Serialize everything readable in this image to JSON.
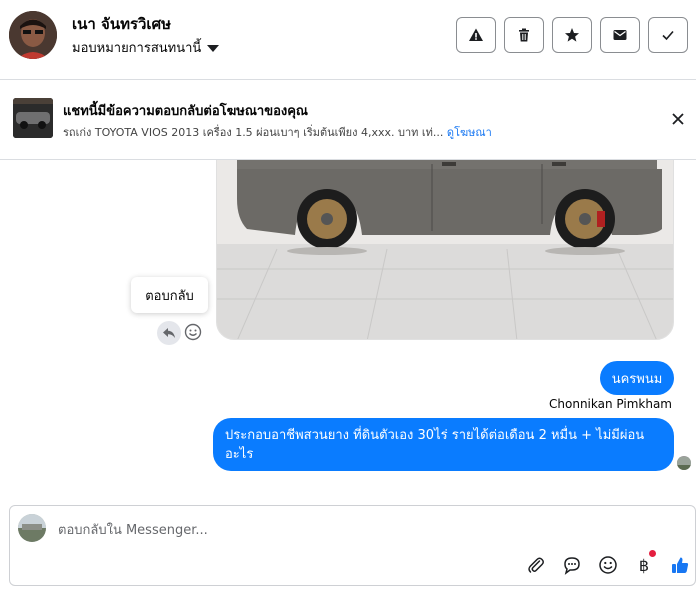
{
  "header": {
    "contact_name": "เนา จันทรวิเศษ",
    "assign_label": "มอบหมายการสนทนานี้",
    "tools": [
      {
        "name": "report-button",
        "icon": "warning-icon"
      },
      {
        "name": "delete-button",
        "icon": "trash-icon"
      },
      {
        "name": "star-button",
        "icon": "star-icon"
      },
      {
        "name": "unread-button",
        "icon": "envelope-icon"
      },
      {
        "name": "done-button",
        "icon": "check-icon"
      }
    ]
  },
  "ad_banner": {
    "title": "แชทนี้มีข้อความตอบกลับต่อโฆษณาของคุณ",
    "subtitle": "รถเก่ง TOYOTA VIOS 2013 เครื่อง 1.5 ผ่อนเบาๆ เริ่มต้นเพียง 4,xxx. บาท เท่...",
    "link_label": "ดูโฆษณา"
  },
  "conversation": {
    "tooltip": "ตอบกลับ",
    "messages": [
      {
        "text": "นครพนม"
      },
      {
        "text": "ประกอบอาชีพสวนยาง ที่ดินตัวเอง 30ไร่ รายได้ต่อเดือน 2 หมื่น + ไม่มีผ่อน อะไร"
      }
    ],
    "sender_name": "Chonnikan Pimkham"
  },
  "composer": {
    "placeholder": "ตอบกลับใน Messenger...",
    "icons": [
      "paperclip-icon",
      "chat-bubble-icon",
      "emoji-icon",
      "baht-icon",
      "thumbs-up-icon"
    ],
    "baht_symbol": "฿",
    "accent": "#0a7cff",
    "like_color": "#1877f2"
  }
}
